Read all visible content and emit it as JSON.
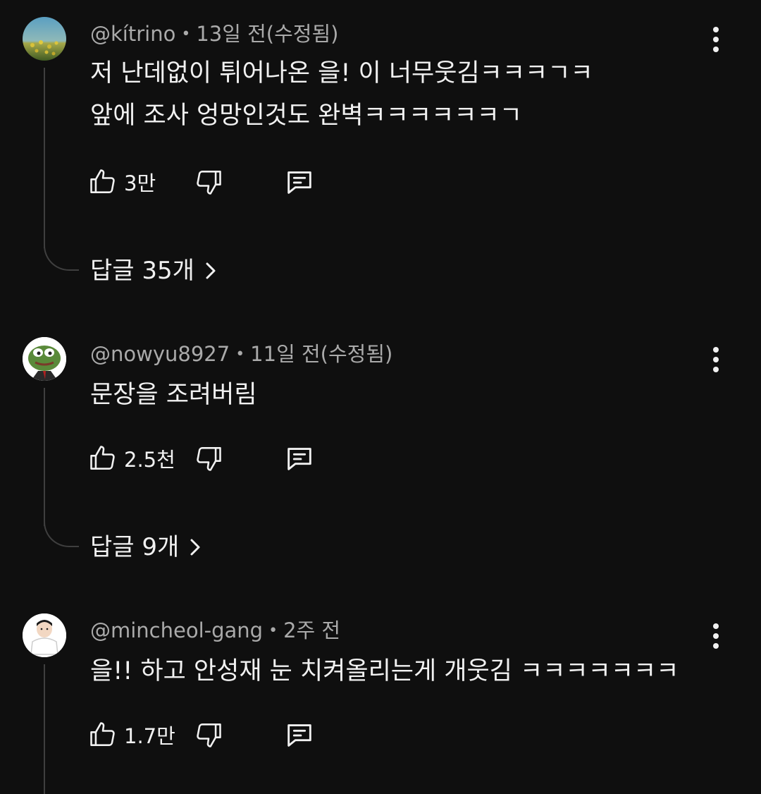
{
  "comments": [
    {
      "author": "@kítrino",
      "time": "13일 전(수정됨)",
      "lines": [
        "저 난데없이 튀어나온 을! 이 너무웃김ㅋㅋㅋㄱㅋ",
        "앞에 조사 엉망인것도 완벽ㅋㅋㅋㅋㅋㅋㄱ"
      ],
      "likes": "3만",
      "replies_label": "답글 35개",
      "avatar_icon": "field-landscape-avatar"
    },
    {
      "author": "@nowyu8927",
      "time": "11일 전(수정됨)",
      "lines": [
        "문장을 조려버림"
      ],
      "likes": "2.5천",
      "replies_label": "답글 9개",
      "avatar_icon": "frog-avatar"
    },
    {
      "author": "@mincheol-gang",
      "time": "2주 전",
      "lines": [
        "을!! 하고 안성재 눈 치켜올리는게 개웃김 ㅋㅋㅋㅋㅋㅋㅋ"
      ],
      "likes": "1.7만",
      "avatar_icon": "person-avatar"
    }
  ],
  "separator": "•",
  "colors": {
    "background": "#0f0f0f",
    "text": "#f1f1f1",
    "meta": "#aaaaaa",
    "thread": "#3f3f3f"
  }
}
